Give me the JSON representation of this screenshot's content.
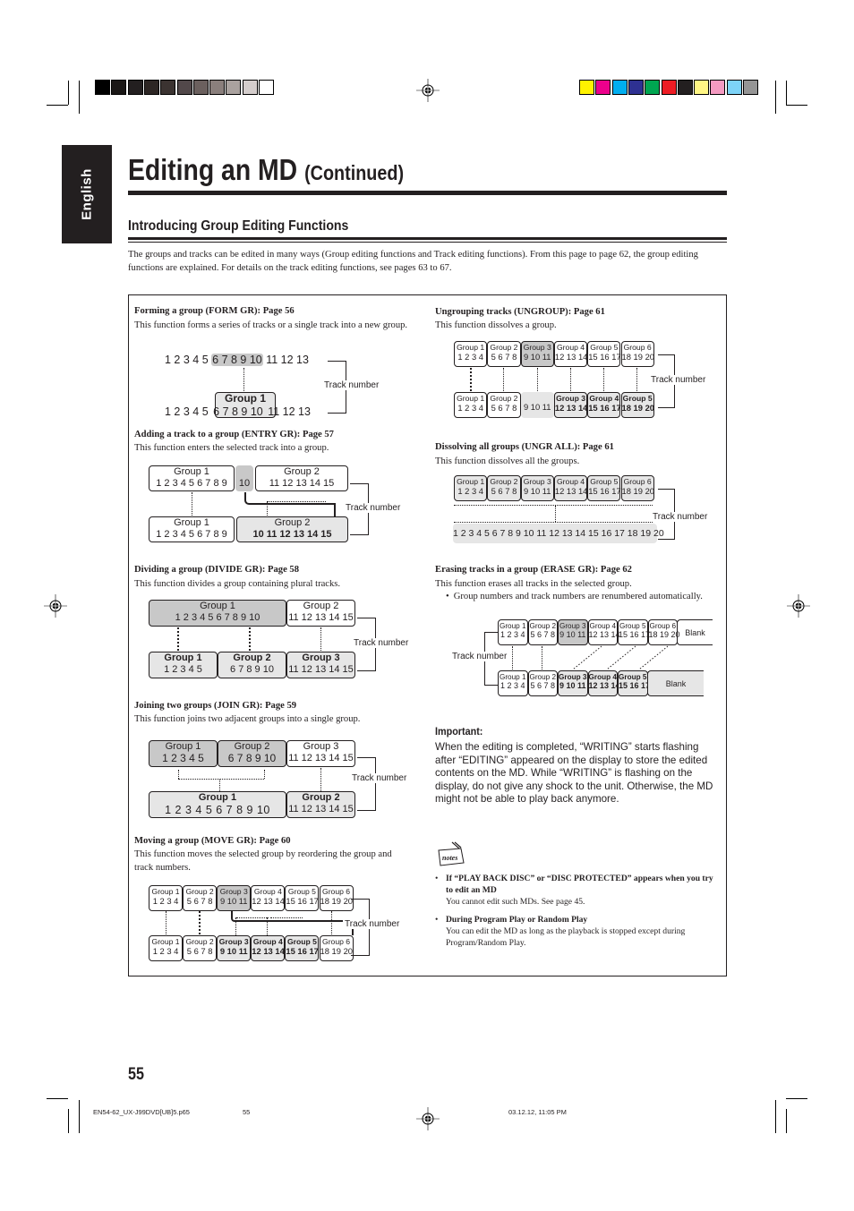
{
  "language_tab": "English",
  "title": {
    "main": "Editing an MD",
    "continued": "(Continued)"
  },
  "subtitle": "Introducing Group Editing Functions",
  "intro": "The groups and tracks can be edited in many ways (Group editing functions and Track editing functions). From this page to page 62, the group editing functions are explained. For details on the track editing functions, see pages 63 to 67.",
  "track_number_label": "Track number",
  "colors": {
    "grays": [
      "#000000",
      "#1a1716",
      "#231f20",
      "#2d2624",
      "#3b3331",
      "#52484a",
      "#6b605e",
      "#8a7f7c",
      "#aaa29f",
      "#d4cdcc",
      "#ffffff"
    ],
    "process": [
      "#fff200",
      "#ec008c",
      "#00aeef",
      "#2e3192",
      "#00a651",
      "#ed1c24",
      "#231f20",
      "#fff685",
      "#f49ac1",
      "#7dd3f7",
      "#959595"
    ],
    "highlight_dark": "#c8c8c8",
    "highlight_light": "#e6e6e6"
  },
  "sections": {
    "form": {
      "heading": "Forming a group (FORM GR): Page 56",
      "desc": "This function forms a series of tracks or a single track into a new group.",
      "top_tracks_a": "1 2 3 4 5",
      "top_tracks_sel": "6 7 8 9 10",
      "top_tracks_b": "11 12 13",
      "bottom_group": "Group 1",
      "bottom_tracks_a": "1 2 3 4 5",
      "bottom_tracks_sel": "6 7 8 9 10",
      "bottom_tracks_b": "11 12 13"
    },
    "entry": {
      "heading": "Adding a track to a group (ENTRY GR): Page 57",
      "desc": "This function enters the selected track into a group.",
      "top": [
        {
          "label": "Group 1",
          "tracks": "1 2 3 4 5 6 7 8 9"
        },
        {
          "label": "",
          "tracks": "10"
        },
        {
          "label": "Group 2",
          "tracks": "11  12  13  14  15"
        }
      ],
      "bottom": [
        {
          "label": "Group 1",
          "tracks": "1 2 3 4 5 6 7 8 9"
        },
        {
          "label": "Group 2",
          "tracks": "10  11  12  13  14  15"
        }
      ]
    },
    "divide": {
      "heading": "Dividing a group (DIVIDE GR): Page 58",
      "desc": "This function divides a group containing plural tracks.",
      "top": [
        {
          "label": "Group 1",
          "tracks": "1  2  3  4  5  6  7  8  9  10"
        },
        {
          "label": "Group 2",
          "tracks": "11 12 13 14 15"
        }
      ],
      "bottom": [
        {
          "label": "Group 1",
          "tracks": "1  2  3  4  5"
        },
        {
          "label": "Group 2",
          "tracks": "6  7  8  9  10"
        },
        {
          "label": "Group 3",
          "tracks": "11 12 13 14 15"
        }
      ]
    },
    "join": {
      "heading": "Joining two groups (JOIN GR): Page 59",
      "desc": "This function joins two adjacent groups into a single group.",
      "top": [
        {
          "label": "Group 1",
          "tracks": "1 2 3 4 5"
        },
        {
          "label": "Group 2",
          "tracks": "6 7 8 9 10"
        },
        {
          "label": "Group 3",
          "tracks": "11 12 13 14 15"
        }
      ],
      "bottom": [
        {
          "label": "Group 1",
          "tracks": "1 2 3 4 5 6 7 8 9 10"
        },
        {
          "label": "Group 2",
          "tracks": "11 12 13 14 15"
        }
      ]
    },
    "move": {
      "heading": "Moving a group (MOVE GR): Page 60",
      "desc": "This function moves the selected group by reordering the group and track numbers.",
      "top": [
        {
          "label": "Group 1",
          "tracks": "1 2 3 4"
        },
        {
          "label": "Group 2",
          "tracks": "5 6 7 8"
        },
        {
          "label": "Group 3",
          "tracks": "9 10 11"
        },
        {
          "label": "Group 4",
          "tracks": "12 13 14"
        },
        {
          "label": "Group 5",
          "tracks": "15 16 17"
        },
        {
          "label": "Group 6",
          "tracks": "18 19 20"
        }
      ],
      "bottom": [
        {
          "label": "Group 1",
          "tracks": "1 2 3 4"
        },
        {
          "label": "Group 2",
          "tracks": "5 6 7 8"
        },
        {
          "label": "Group 3",
          "tracks": "9 10 11"
        },
        {
          "label": "Group 4",
          "tracks": "12 13 14"
        },
        {
          "label": "Group 5",
          "tracks": "15 16 17"
        },
        {
          "label": "Group 6",
          "tracks": "18 19 20"
        }
      ]
    },
    "ungroup": {
      "heading": "Ungrouping tracks (UNGROUP): Page 61",
      "desc": "This function dissolves a group.",
      "top": [
        {
          "label": "Group 1",
          "tracks": "1 2 3 4"
        },
        {
          "label": "Group 2",
          "tracks": "5 6 7 8"
        },
        {
          "label": "Group 3",
          "tracks": "9 10 11"
        },
        {
          "label": "Group 4",
          "tracks": "12 13 14"
        },
        {
          "label": "Group 5",
          "tracks": "15 16 17"
        },
        {
          "label": "Group 6",
          "tracks": "18 19 20"
        }
      ],
      "bottom": [
        {
          "label": "Group 1",
          "tracks": "1 2 3 4"
        },
        {
          "label": "Group 2",
          "tracks": "5 6 7 8"
        },
        {
          "label": "",
          "tracks": "9 10 11"
        },
        {
          "label": "Group 3",
          "tracks": "12 13 14"
        },
        {
          "label": "Group 4",
          "tracks": "15 16 17"
        },
        {
          "label": "Group 5",
          "tracks": "18 19 20"
        }
      ]
    },
    "ungr_all": {
      "heading": "Dissolving all groups (UNGR ALL): Page 61",
      "desc": "This function dissolves all the groups.",
      "top": [
        {
          "label": "Group 1",
          "tracks": "1 2 3 4"
        },
        {
          "label": "Group 2",
          "tracks": "5 6 7 8"
        },
        {
          "label": "Group 3",
          "tracks": "9 10 11"
        },
        {
          "label": "Group 4",
          "tracks": "12 13 14"
        },
        {
          "label": "Group 5",
          "tracks": "15 16 17"
        },
        {
          "label": "Group 6",
          "tracks": "18 19 20"
        }
      ],
      "bottom_tracks": "1 2 3 4 5 6 7 8 9 10 11 12 13 14 15 16 17 18 19 20"
    },
    "erase": {
      "heading": "Erasing tracks in a group (ERASE GR): Page 62",
      "desc": "This function erases all tracks in the selected group.",
      "bullet": "Group numbers and track numbers are renumbered automatically.",
      "blank_label": "Blank",
      "top": [
        {
          "label": "Group 1",
          "tracks": "1 2 3 4"
        },
        {
          "label": "Group 2",
          "tracks": "5 6 7 8"
        },
        {
          "label": "Group 3",
          "tracks": "9 10 11"
        },
        {
          "label": "Group 4",
          "tracks": "12 13 14"
        },
        {
          "label": "Group 5",
          "tracks": "15 16 17"
        },
        {
          "label": "Group 6",
          "tracks": "18 19 20"
        }
      ],
      "bottom": [
        {
          "label": "Group 1",
          "tracks": "1 2 3 4"
        },
        {
          "label": "Group 2",
          "tracks": "5 6 7 8"
        },
        {
          "label": "Group 3",
          "tracks": "9 10 11"
        },
        {
          "label": "Group 4",
          "tracks": "12 13 14"
        },
        {
          "label": "Group 5",
          "tracks": "15 16 17"
        }
      ]
    }
  },
  "important": {
    "heading": "Important:",
    "text": "When the editing is completed, “WRITING” starts flashing after “EDITING” appeared on the display to store the edited contents on the MD. While “WRITING” is flashing on the display, do not give any shock to the unit. Otherwise, the MD might not be able to play back anymore."
  },
  "notes": {
    "icon_label": "notes",
    "items": [
      {
        "title": "If “PLAY BACK DISC” or “DISC PROTECTED” appears when you try to edit an MD",
        "body": "You cannot edit such MDs. See page 45."
      },
      {
        "title": "During Program Play or Random Play",
        "body": "You can edit the MD as long as the playback is stopped except during Program/Random Play."
      }
    ]
  },
  "page_number": "55",
  "footer": {
    "file": "EN54-62_UX-J99DVD[UB]5.p65",
    "page": "55",
    "timestamp": "03.12.12, 11:05 PM"
  }
}
